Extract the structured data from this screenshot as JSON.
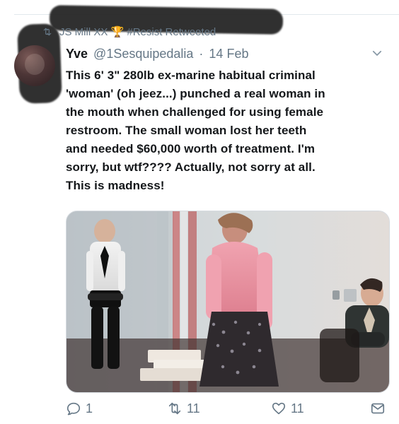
{
  "retweet_notice": {
    "text": "JS Mill XX 🏆 #Resist Retweeted",
    "icon": "retweet-icon"
  },
  "tweet": {
    "author": {
      "name": "Yve",
      "handle": "@1Sesquipedalia",
      "date": "14 Feb"
    },
    "text": "This 6' 3\" 280lb ex-marine habitual criminal\n'woman' (oh jeez...) punched a real woman in\nthe mouth when challenged for using female\nrestroom. The small woman lost her teeth\nand needed $60,000 worth of treatment. I'm\nsorry, but wtf???? Actually, not sorry at all.\nThis is madness!",
    "actions": {
      "reply_count": "1",
      "retweet_count": "11",
      "like_count": "11"
    }
  },
  "icons": {
    "caret": "chevron-down-icon",
    "reply": "reply-icon",
    "retweet": "retweet-icon",
    "like": "heart-icon",
    "mail": "mail-icon"
  },
  "colors": {
    "text_primary": "#14171a",
    "text_secondary": "#657786",
    "divider": "#e1e8ed",
    "accent": "#1da1f2"
  }
}
